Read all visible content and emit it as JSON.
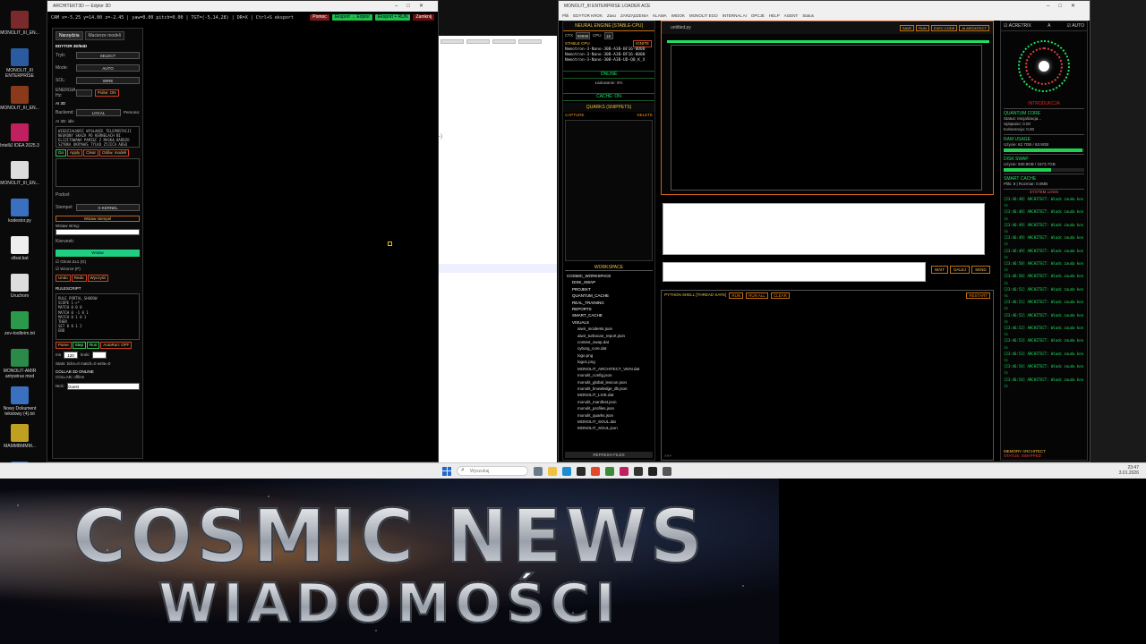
{
  "desktop": {
    "icons": [
      {
        "label": "MONOLIT_III_EN...",
        "color": "#7a2a2a"
      },
      {
        "label": "MONOLIT_III ENTERPRISE",
        "color": "#2a5aa0"
      },
      {
        "label": "MONOLIT_III_EN...",
        "color": "#8a3a1a"
      },
      {
        "label": "IntelliJ IDEA 2025.3",
        "color": "#c02060"
      },
      {
        "label": "MONOLIT_III_EN...",
        "color": "#dddddd"
      },
      {
        "label": "kodestor.py",
        "color": "#3a70c0"
      },
      {
        "label": "ztbat.bat",
        "color": "#eeeeee"
      },
      {
        "label": "Uruchom",
        "color": "#dddddd"
      },
      {
        "label": "zev-toolbrim.txt",
        "color": "#2a9a4a"
      },
      {
        "label": "MONOLIT-AMIR antywirus mod",
        "color": "#2a8a4a"
      },
      {
        "label": "Nowy Dokument tekstowy (4).txt",
        "color": "#3a70c0"
      },
      {
        "label": "MAMMBMMM...",
        "color": "#c0a020"
      },
      {
        "label": "Nowy Dokument tekstowy (5).txt",
        "color": "#3a70c0"
      }
    ]
  },
  "editor": {
    "title": "ARCHITEKT3D — Edytor 3D",
    "hud": "CAM x=-5.25 y=14.00 z=-2.45 | yaw=0.00 pitch=0.00 | TGT=(-5,14,28) | DR=X | Ctrl+S eksport",
    "buttons": {
      "help": "Pomoc",
      "export_edytor": "Eksport → Edytor",
      "export_run": "Eksport + RUN",
      "close": "Zamknij"
    },
    "tabs": [
      "Narzędzia",
      "Macierze modeli"
    ],
    "panel_title": "EDYTOR 3D/64D",
    "tryb_label": "Tryb:",
    "tryb_value": "SELECT",
    "mode_label": "Mode:",
    "mode_value": "AUTO",
    "sol_label": "SOL:",
    "sol_value": "WIRE",
    "energia_label": "ENERGIA Hz:",
    "pulse_label": "Pulse: ON",
    "ai_title": "AI 3D",
    "backend_label": "Backend:",
    "backend_value": "LOCAL",
    "persona_label": "Persona:",
    "ai_status": "AI 3D: idle",
    "prompt_text": "WIEDZIALNOŚĆ WYSŁANIE TELEPORTACJI NEURONY SKAZA PO KERNELACH NI ELIZITOWANA PAMIĘĆ Z MASKĄ BARDZO SZYBKA UKRYWAŚ TYLKO ZYJICA ABSO UJRZEŃ 3D MOI",
    "ai_buttons": [
      "Go",
      "Apply",
      "Clear",
      "Odśw. modeli"
    ],
    "podcel_label": "Podcel:",
    "stempel_label": "Stempel:",
    "stempel_value": "X-KERNEL",
    "wstaw_stempel": "Wstaw stempel",
    "wstaw_string_label": "Wstaw string:",
    "kierunek_label": "Kierunek:",
    "wstaw_btn": "Wstaw",
    "ghost_label": "Ghost Z±1 (G)",
    "wzorce_label": "Wzorce (P)",
    "undo": "Undo",
    "redo": "Redo",
    "clear": "Wyczyść",
    "rulescript_title": "RULESCRIPT",
    "rulescript_code": "RULE PORTAL_SHADOW\nSCOPE 1->*\nMATCH 0 0 0\nMATCH 0 -1 0 1\nMATCH 0 1 0 1\nTHEN\nSET 0 0 1 2\nEND",
    "parse": "Parse",
    "step": "Step",
    "run": "Run",
    "autorun": "AutoRun: OFF",
    "ms_label": "ms",
    "ms_value": "120",
    "krok_label": "kroki",
    "stats": "Stats: ticks=0 match=0 write=0",
    "collab_title": "COLLAB 3D ONLINE",
    "collab_status": "COLLAB: offline",
    "nick_label": "Nick:",
    "nick_value": "Guest"
  },
  "monolit": {
    "title": "MONOLIT_III ENTERPRISE LOADER ACE",
    "menu": [
      "Plik",
      "EDYTOR KROK",
      "Zaso",
      "ZARZĄDZENIA",
      "KLAWA",
      "WIDOK",
      "MONOLIT EGO",
      "INTERNAL AI",
      "OPCJE",
      "HELP",
      "AGENT",
      "Status"
    ],
    "neural_title": "NEURAL ENGINE [STABLE-CPU]",
    "ctx_label": "CTX",
    "ctx_value": "99999",
    "cpu_label": "CPU",
    "cpu_value": "16",
    "stable_label": "STABLE CPU",
    "ignite": "IGNITE",
    "models": [
      "Nemotron-3-Nano-30B-A3B-BF16-0000",
      "Nemotron-3-Nano-30B-A3B-BF16-0000",
      "Nemotron-3-Nano-30B-A3B-UD-Q8_K_X"
    ],
    "online": "ONLINE",
    "loading": "Ładowanie: 0%",
    "cache": "CACHE: ON",
    "quarks_title": "QUARKS (SNIPPETS)",
    "capture": "CAPTURE",
    "delete": "DELETE",
    "workspace_title": "WORKSPACE",
    "tree_root": "COSMIC_WORKSPACE",
    "tree_dirs": [
      "DISK_SWAP",
      "PROJEKT",
      "QUANTUM_CACHE",
      "REAL_TRAINING",
      "REPORTS",
      "SMART_CACHE",
      "VISUALS"
    ],
    "tree_files": [
      "aiwir_incidents.json",
      "aiwir_turbocan_report.json",
      "context_swap.dat",
      "cyborg_core.dat",
      "logo.png",
      "logo1.png",
      "MONOLIT_ARCHITECT_VEIN.dat",
      "monolit_config.json",
      "monolit_global_lexicon.json",
      "monolit_knowledge_db.json",
      "MONOLIT_LIVE.dat",
      "monolit_manifest.json",
      "monolit_profiles.json",
      "monolit_quarks.json",
      "MONOLIT_SOUL.dat",
      "MONOLIT_SOUL.json"
    ],
    "refresh": "REFRESH FILES",
    "editor_tab": "untitled.py",
    "editor_actions": [
      "SAVE",
      "RUN",
      "EXEC.CODE",
      "AI ARCHITECT"
    ],
    "send_buttons": [
      "WAIT",
      "DALEJ",
      "SEND"
    ],
    "shell_title": "PYTHON SHELL [THREAD SAFE]",
    "shell_buttons": [
      "RUN",
      "RUN ALL",
      "CLEAR"
    ],
    "shell_right": "RESTART",
    "shell_prompt": ">>>",
    "accel_label": "ACRETRIX",
    "accel_mode": "A",
    "auto_label": "AUTO",
    "orb_label": "INTRODUKCJA",
    "quantum_title": "QUANTUM CORE",
    "quantum_status": "Status: Inicjalizacja...",
    "quantum_split": "Splątanie: 0.00",
    "quantum_coh": "Koherencja: 0.00",
    "ram_title": "RAM USAGE",
    "ram_value": "Użycie: 62.7GB / 63.9GB",
    "ram_frac": 0.98,
    "disk_title": "DISK SWAP",
    "disk_value": "Użycie: 930.9GB / 1573.7GB",
    "disk_frac": 0.59,
    "smart_title": "SMART CACHE",
    "smart_value": "Pliki: 8 | Rozmiar: 0.0MB",
    "logs_title": "SYSTEM LOGS",
    "logs": [
      "[23:46:48] ARCHITECT: Wiadc zauda kon (s",
      "[23:46:48] ARCHITECT: Wiadc zauda kon (s",
      "[23:46:49] ARCHITECT: Wiadc zauda kon (s",
      "[23:46:49] ARCHITECT: Wiadc zauda kon (s",
      "[23:46:49] ARCHITECT: Wiadc zauda kon (s",
      "[23:46:50] ARCHITECT: Wiadc zauda kon (s",
      "[23:46:50] ARCHITECT: Wiadc zauda kon (s",
      "[23:46:51] ARCHITECT: Wiadc zauda kon (s",
      "[23:46:51] ARCHITECT: Wiadc zauda kon (s",
      "[23:46:52] ARCHITECT: Wiadc zauda kon (s",
      "[23:46:52] ARCHITECT: Wiadc zauda kon (s",
      "[23:46:53] ARCHITECT: Wiadc zauda kon (s",
      "[23:46:53] ARCHITECT: Wiadc zauda kon (s",
      "[23:46:54] ARCHITECT: Wiadc zauda kon (s",
      "[23:46:54] ARCHITECT: Wiadc zauda kon (s",
      "[23:46:55] ARCHITECT: Wiadc zauda kon (s",
      "[23:46:55] ARCHITECT: Wiadc zauda kon (s",
      "[23:46:56] ARCHITECT: Wiadc zauda kon (s",
      "[23:46:56] ARCHITECT: Wiadc zauda kon (s",
      "[23:46:57] ARCHITECT: Wiadc zauda kon (s",
      "[23:46:57] ARCHITECT: Wiadc zauda kon (s",
      "[23:46:58] ARCHITECT: Wiadc zauda kon (s",
      "[23:46:58] ARCHITECT: Wiadc zauda kon (s",
      "[23:46:59] ARCHITECT: Wiadc zauda kon (s",
      "[23:46:59] ARCHITECT: Wiadc zauda kon (s",
      "[23:47:00] ARCHITECT: Wiadc zauda kon (s",
      "[23:47:00] ARCHITECT: Wiadc zauda kon (s",
      "[23:47:01] ARCHITECT: Wiadc zauda kon (s",
      "[23:47:01] ARCHITECT: Wiadc zauda kon (s"
    ],
    "memory_architect": "MEMORY ARCHITECT",
    "memory_status": "STATUS: SWAPPED"
  },
  "taskbar": {
    "search_placeholder": "Wyszukaj",
    "time": "23:47",
    "date": "3.01.2026"
  },
  "banner": {
    "title": "COSMIC NEWS",
    "subtitle": "WIADOMOŚCI"
  }
}
